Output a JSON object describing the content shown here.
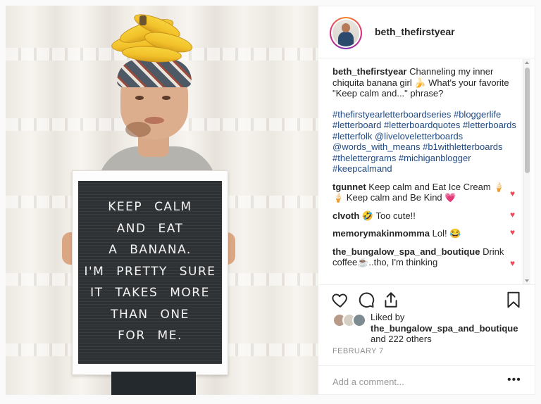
{
  "post": {
    "username": "beth_thefirstyear",
    "letterboard_lines": [
      "KEEP CALM",
      "AND EAT",
      "A BANANA.",
      "I'M PRETTY SURE",
      "IT TAKES MORE",
      "THAN ONE",
      "FOR ME."
    ]
  },
  "caption": {
    "username": "beth_thefirstyear",
    "text": " Channeling my inner chiquita banana girl 🍌 What's your favorite \"Keep calm and...\" phrase?",
    "hashtags": "#thefirstyearletterboardseries #bloggerlife #letterboard #letterboardquotes #letterboards #letterfolk @liveloveletterboards @words_with_means #b1withletterboards #thelettergrams #michiganblogger #keepcalmand"
  },
  "comments": [
    {
      "username": "tgunnet",
      "text": " Keep calm and Eat Ice Cream 🍦🍦 Keep calm and Be Kind 💗"
    },
    {
      "username": "clvoth",
      "text": " 🤣 Too cute!!"
    },
    {
      "username": "memorymakinmomma",
      "text": " Lol! 😂"
    },
    {
      "username": "the_bungalow_spa_and_boutique",
      "text": " Drink coffee☕..tho, I'm thinking"
    }
  ],
  "likes": {
    "liked_by_prefix": "Liked by",
    "liked_by_user": "the_bungalow_spa_and_boutique",
    "others_text": "and 222 others"
  },
  "date": "FEBRUARY 7",
  "add_comment": {
    "placeholder": "Add a comment...",
    "more_label": "•••"
  },
  "icons": {
    "like": "heart-outline-icon",
    "comment": "comment-bubble-icon",
    "share": "share-icon",
    "save": "bookmark-icon",
    "comment_like": "heart-filled-icon"
  },
  "colors": {
    "hashtag": "#1f4b87",
    "heart": "#ed4956",
    "muted": "#8e8e8e",
    "text": "#262626"
  }
}
